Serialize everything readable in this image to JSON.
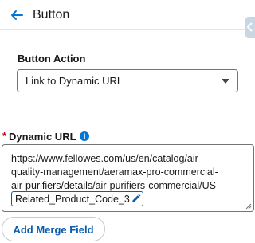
{
  "header": {
    "title": "Button"
  },
  "button_action": {
    "label": "Button Action",
    "selected": "Link to Dynamic URL"
  },
  "dynamic_url": {
    "required_marker": "*",
    "label": "Dynamic URL",
    "lines": [
      "https://www.fellowes.com/us/en/catalog/air-",
      "quality-management/aeramax-pro-commercial-",
      "air-purifiers/details/air-purifiers-commercial/US-"
    ],
    "merge_field": "Related_Product_Code_3"
  },
  "add_merge_field_label": "Add Merge Field",
  "colors": {
    "brand_blue": "#0b5cab",
    "info_blue": "#0176d3",
    "required_red": "#ba0517"
  },
  "icons": [
    "back-arrow-icon",
    "chevron-down-icon",
    "info-icon",
    "pencil-icon",
    "collapse-chevron-icon",
    "resize-grip-icon"
  ]
}
